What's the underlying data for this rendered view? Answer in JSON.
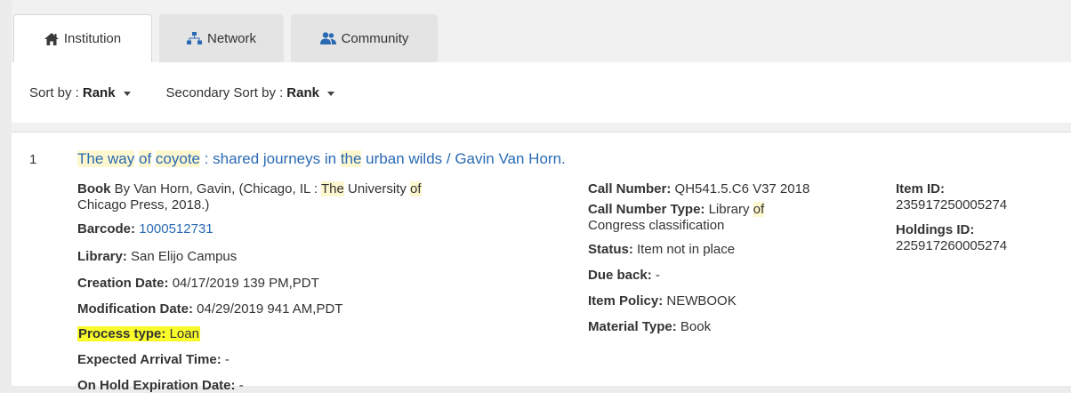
{
  "tabs": [
    {
      "label": "Institution",
      "icon": "home-icon"
    },
    {
      "label": "Network",
      "icon": "sitemap-icon"
    },
    {
      "label": "Community",
      "icon": "users-icon"
    }
  ],
  "sort": {
    "primary_label": "Sort by :",
    "primary_value": "Rank",
    "secondary_label": "Secondary Sort by :",
    "secondary_value": "Rank"
  },
  "result": {
    "index": "1",
    "title": {
      "p1": "The way",
      "p2": "of",
      "p3": "coyote",
      "p4": " : shared journeys in ",
      "p5": "the",
      "p6": " urban wilds / Gavin Van Horn."
    },
    "book": {
      "label": "Book",
      "text1": " By Van Horn, Gavin, (Chicago, IL : ",
      "the": "The",
      "text2": " University ",
      "of": "of",
      "line2": "Chicago Press, 2018.)"
    },
    "barcode": {
      "label": "Barcode:",
      "value": "1000512731"
    },
    "library": {
      "label": "Library:",
      "value": "San Elijo Campus"
    },
    "creation_date": {
      "label": "Creation Date:",
      "value": "04/17/2019 139 PM,PDT"
    },
    "modification_date": {
      "label": "Modification Date:",
      "value": "04/29/2019 941 AM,PDT"
    },
    "process_type": {
      "label": "Process type:",
      "value": "Loan"
    },
    "expected_arrival": {
      "label": "Expected Arrival Time:",
      "value": "-"
    },
    "on_hold_expiration": {
      "label": "On Hold Expiration Date:",
      "value": "-"
    },
    "call_number": {
      "label": "Call Number:",
      "value": "QH541.5.C6 V37 2018"
    },
    "call_number_type": {
      "label": "Call Number Type:",
      "value1": "Library",
      "of": "of",
      "value2": "Congress classification"
    },
    "status": {
      "label": "Status:",
      "value": "Item not in place"
    },
    "due_back": {
      "label": "Due back:",
      "value": "-"
    },
    "item_policy": {
      "label": "Item Policy:",
      "value": "NEWBOOK"
    },
    "material_type": {
      "label": "Material Type:",
      "value": "Book"
    },
    "item_id": {
      "label": "Item ID:",
      "value": "235917250005274"
    },
    "holdings_id": {
      "label": "Holdings ID:",
      "value": "225917260005274"
    }
  },
  "colors": {
    "link": "#2a6ab3",
    "search_highlight": "#fdf7cf",
    "marker_highlight": "#fafb2a"
  }
}
